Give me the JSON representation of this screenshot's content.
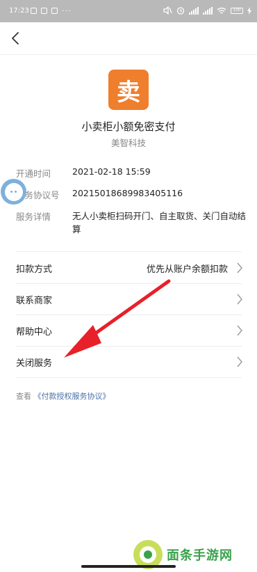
{
  "status_bar": {
    "time": "17:23",
    "more": "···",
    "battery": "100"
  },
  "nav": {
    "back_icon": "back-arrow-icon"
  },
  "merchant": {
    "logo_char": "卖",
    "service_title": "小卖柜小额免密支付",
    "merchant_name": "美智科技"
  },
  "info": {
    "open_time_label": "开通时间",
    "open_time_value": "2021-02-18 15:59",
    "agreement_no_label": "服务协议号",
    "agreement_no_value": "20215018689983405116",
    "details_label": "服务详情",
    "details_value": "无人小卖柜扫码开门、自主取货、关门自动结算"
  },
  "rows": {
    "deduction_label": "扣款方式",
    "deduction_value": "优先从账户余额扣款",
    "contact_label": "联系商家",
    "help_label": "帮助中心",
    "close_label": "关闭服务"
  },
  "footer": {
    "prefix": "查看",
    "link": "《付款授权服务协议》"
  },
  "watermark": {
    "text": "面条手游网"
  },
  "colors": {
    "logo": "#ef7e2d",
    "link": "#4a6fa5",
    "annotation_arrow": "#e8202a",
    "status_bar": "#b9b9b9"
  }
}
